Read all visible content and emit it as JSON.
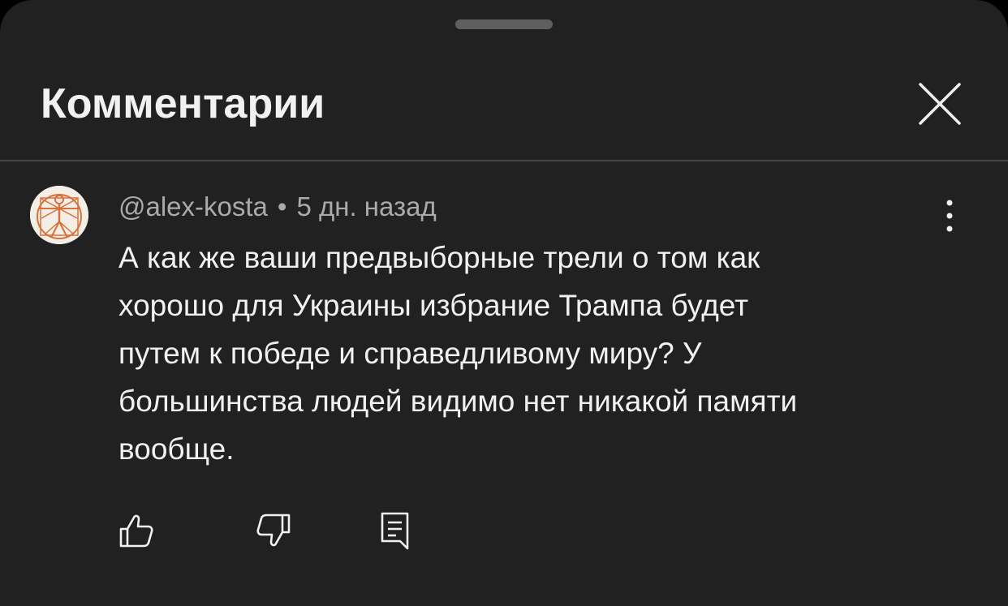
{
  "panel": {
    "title": "Комментарии"
  },
  "icons": {
    "drag_handle": "drag-handle-bar",
    "close": "close-icon",
    "more": "more-vertical-icon",
    "like": "thumb-up-icon",
    "dislike": "thumb-down-icon",
    "reply": "reply-comment-icon"
  },
  "comment": {
    "author": "@alex-kosta",
    "separator": "•",
    "time": "5 дн. назад",
    "text": "А как же ваши предвыборные трели о том как\nхорошо для Украины избрание Трампа будет\nпутем к победе и справедливому миру? У\nбольшинства людей видимо нет никакой памяти\nвообще."
  },
  "colors": {
    "sheet_background": "#212121",
    "primary_text": "#f1f1f1",
    "secondary_text": "#aaaaaa",
    "divider": "#444444",
    "avatar_sketch": "#d9703a"
  }
}
